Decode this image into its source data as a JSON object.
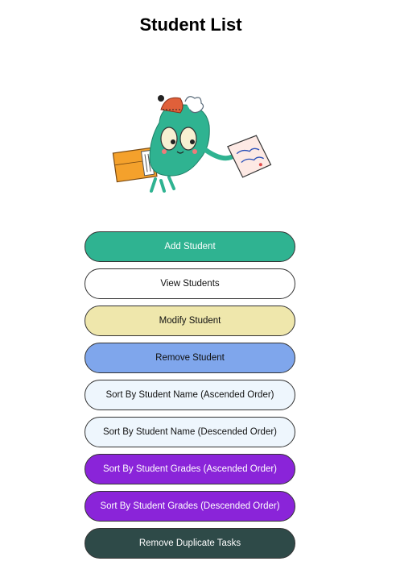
{
  "page": {
    "title": "Student List"
  },
  "illustration": {
    "icon": "mascot-carrying-box-and-paper-icon"
  },
  "buttons": [
    {
      "label": "Add Student",
      "bg": "#2fb391",
      "fg": "#ffffff"
    },
    {
      "label": "View Students",
      "bg": "#ffffff",
      "fg": "#111111"
    },
    {
      "label": "Modify Student",
      "bg": "#efe7ac",
      "fg": "#111111"
    },
    {
      "label": "Remove Student",
      "bg": "#7fa6ec",
      "fg": "#111111"
    },
    {
      "label": "Sort By Student Name (Ascended Order)",
      "bg": "#eef6fd",
      "fg": "#111111"
    },
    {
      "label": "Sort By Student Name (Descended Order)",
      "bg": "#eef6fd",
      "fg": "#111111"
    },
    {
      "label": "Sort By Student Grades (Ascended Order)",
      "bg": "#8a24d9",
      "fg": "#ffffff"
    },
    {
      "label": "Sort By Student Grades (Descended Order)",
      "bg": "#8a24d9",
      "fg": "#ffffff"
    },
    {
      "label": "Remove Duplicate Tasks",
      "bg": "#2e4a48",
      "fg": "#ffffff"
    }
  ]
}
